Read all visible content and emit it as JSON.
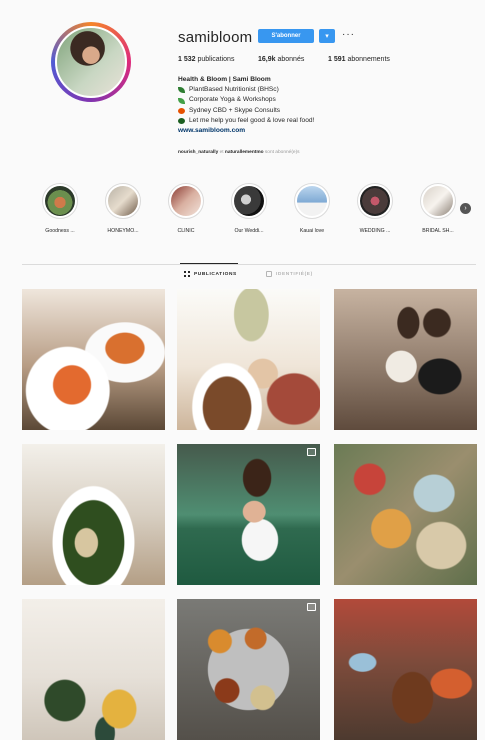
{
  "profile": {
    "username": "samibloom",
    "follow_label": "S'abonner",
    "dropdown_icon": "caret-down-icon",
    "more_label": "···",
    "stats": [
      {
        "value": "1 532",
        "label": " publications"
      },
      {
        "value": "16,9k",
        "label": " abonnés"
      },
      {
        "value": "1 591",
        "label": " abonnements"
      }
    ],
    "bio": {
      "name": "Health & Bloom | Sami Bloom",
      "lines": [
        {
          "text": "PlantBased Nutritionist (BHSc)",
          "color": "#2e7d32"
        },
        {
          "text": "Corporate Yoga & Workshops",
          "color": "#43a047"
        },
        {
          "text": "Sydney CBD + Skype Consults",
          "color": "#e65100"
        },
        {
          "text": "Let me help you feel good & love real food!",
          "color": "#1b5e20"
        }
      ],
      "link": "www.samibloom.com"
    },
    "followed_by": {
      "user1": "nourish_naturally",
      "and": " et ",
      "user2": "naturallementmo",
      "suffix": " sont abonné(e)s"
    }
  },
  "stories": [
    {
      "label": "Goodness ..."
    },
    {
      "label": "HONEYMO..."
    },
    {
      "label": "CLINIC"
    },
    {
      "label": "Our Weddi..."
    },
    {
      "label": "Kauai love"
    },
    {
      "label": "WEDDING ..."
    },
    {
      "label": "BRIDAL SH..."
    }
  ],
  "tabs": {
    "publications": "PUBLICATIONS",
    "identified": "IDENTIFIÉ(E)"
  },
  "accent": "#3897f0"
}
